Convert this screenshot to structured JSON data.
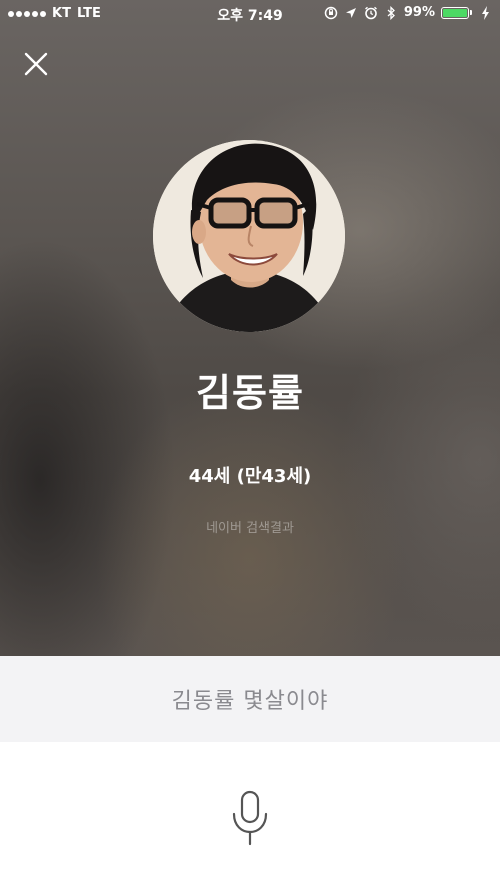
{
  "status_bar": {
    "carrier": "KT",
    "network": "LTE",
    "time": "오후 7:49",
    "battery_percent": "99%",
    "battery_level": 0.99,
    "battery_color": "#4cd964"
  },
  "result": {
    "close_icon": "close-icon",
    "name": "김동률",
    "age": "44세 (만43세)",
    "source": "네이버 검색결과"
  },
  "query": {
    "text": "김동률 몇살이야"
  },
  "mic": {
    "icon": "microphone-icon"
  }
}
